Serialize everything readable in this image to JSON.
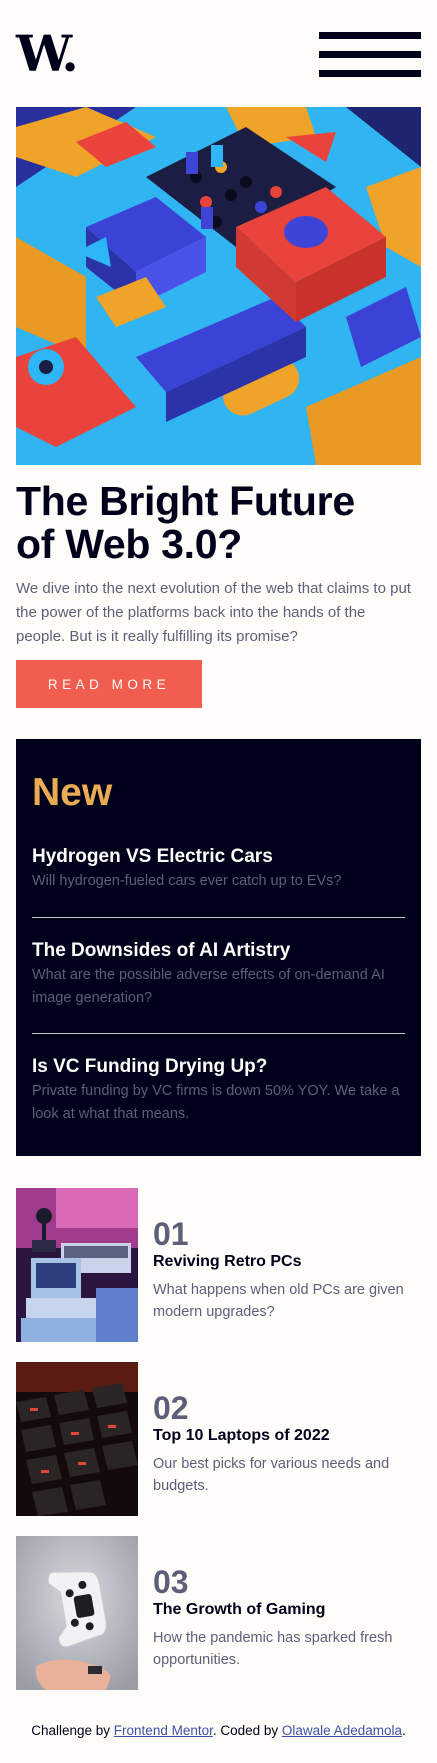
{
  "header": {
    "logo": "W.",
    "menu_icon": "hamburger-menu-icon"
  },
  "hero": {
    "title_line1": "The Bright Future",
    "title_line2": "of Web 3.0?",
    "description": "We dive into the next evolution of the web that claims to put the power of the platforms back into the hands of the people. But is it really fulfilling its promise?",
    "button_label": "READ MORE",
    "button_color": "#f15e50"
  },
  "new_section": {
    "heading": "New",
    "items": [
      {
        "title": "Hydrogen VS Electric Cars",
        "description": "Will hydrogen-fueled cars ever catch up to EVs?"
      },
      {
        "title": "The Downsides of AI Artistry",
        "description": "What are the possible adverse effects of on-demand AI image generation?"
      },
      {
        "title": "Is VC Funding Drying Up?",
        "description": "Private funding by VC firms is down 50% YOY. We take a look at what that means."
      }
    ]
  },
  "articles": [
    {
      "number": "01",
      "title": "Reviving Retro PCs",
      "description": "What happens when old PCs are given modern upgrades?"
    },
    {
      "number": "02",
      "title": "Top 10 Laptops of 2022",
      "description": "Our best picks for various needs and budgets."
    },
    {
      "number": "03",
      "title": "The Growth of Gaming",
      "description": "How the pandemic has sparked fresh opportunities."
    }
  ],
  "footer": {
    "prefix": "Challenge by ",
    "link1": "Frontend Mentor",
    "middle": ". Coded by ",
    "link2": "Olawale Adedamola",
    "suffix": "."
  },
  "colors": {
    "accent_red": "#f15e50",
    "accent_orange": "#e9ab53",
    "dark_navy": "#00001a",
    "grayish_blue": "#5d5f79",
    "off_white": "#fffdfa"
  }
}
